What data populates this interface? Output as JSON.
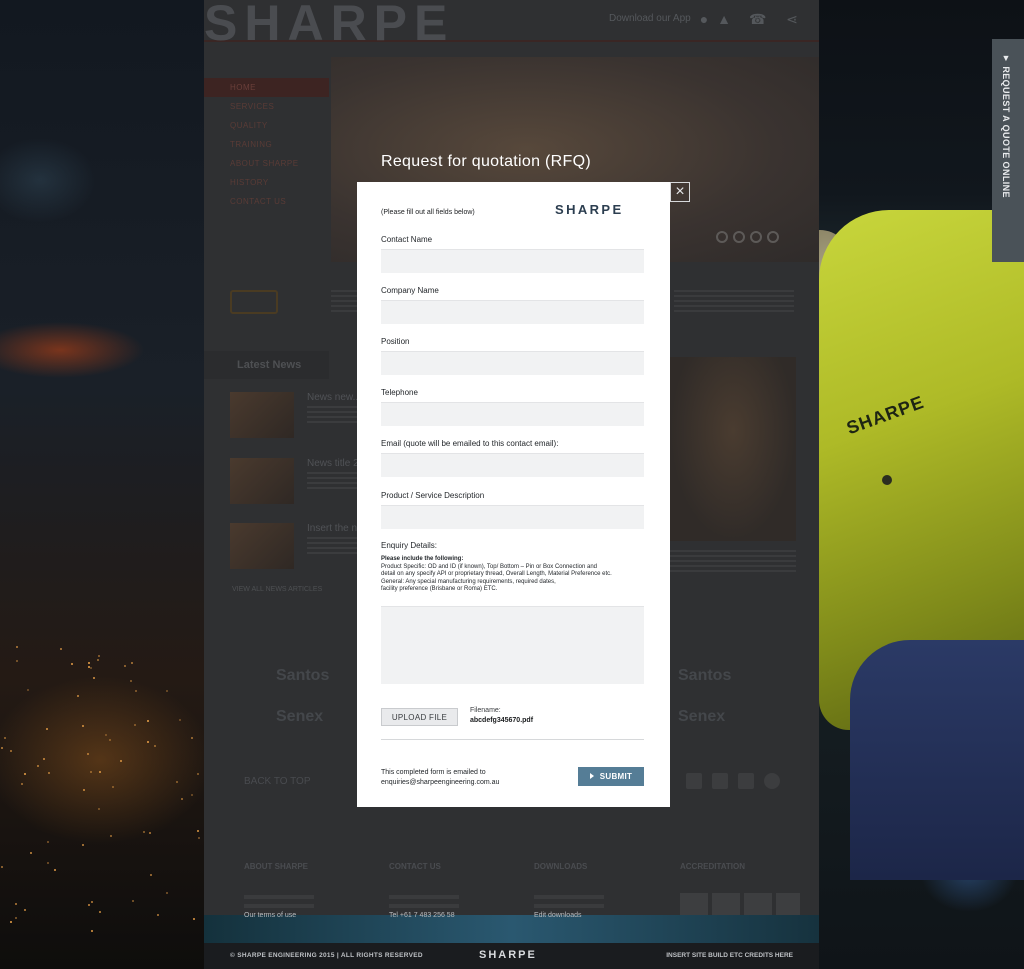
{
  "site": {
    "logo": "SHARPE",
    "download_app": "Download our App",
    "nav": [
      "HOME",
      "SERVICES",
      "QUALITY",
      "TRAINING",
      "ABOUT SHARPE",
      "HISTORY",
      "CONTACT US"
    ],
    "latest_news": "Latest News",
    "news_titles": [
      "News new...",
      "News title 2",
      "Insert the n..."
    ],
    "view_all": "VIEW ALL NEWS ARTICLES",
    "partners": [
      "Santos",
      "Senex",
      "Santos",
      "Senex"
    ],
    "back_to_top": "BACK TO TOP",
    "footer_cols": [
      "ABOUT SHARPE",
      "CONTACT US",
      "DOWNLOADS",
      "ACCREDITATION"
    ],
    "footer_bright": [
      "Our terms of use",
      "Tel +61 7 483 256 58",
      "Edit downloads"
    ],
    "copyright": "© SHARPE ENGINEERING 2015  |  ALL RIGHTS RESERVED",
    "bottom_brand": "SHARPE",
    "credits": "INSERT SITE BUILD ETC CREDITS HERE"
  },
  "quote_tab": {
    "label": "REQUEST A QUOTE ONLINE"
  },
  "modal": {
    "title": "Request for quotation (RFQ)",
    "close": "×",
    "note": "(Please fill out all fields below)",
    "logo": "SHARPE",
    "fields": {
      "contact_name": {
        "label": "Contact Name",
        "value": ""
      },
      "company_name": {
        "label": "Company Name",
        "value": ""
      },
      "position": {
        "label": "Position",
        "value": ""
      },
      "telephone": {
        "label": "Telephone",
        "value": ""
      },
      "email": {
        "label": "Email (quote will be emailed to this contact email):",
        "value": ""
      },
      "product": {
        "label": "Product / Service Description",
        "value": ""
      }
    },
    "enquiry": {
      "label": "Enquiry Details:",
      "include": "Please include the following:",
      "line1": "Product Specific: OD and ID (if known), Top/ Bottom – Pin or Box Connection and",
      "line2": "detail on any specify API or proprietary thread, Overall Length, Material Preference etc.",
      "line3": "General: Any special manufacturing requirements, required dates,",
      "line4": "facility preference (Brisbane or Roma) ETC."
    },
    "upload_label": "UPLOAD FILE",
    "filename_label": "Filename:",
    "filename": "abcdefg345670.pdf",
    "email_note_1": "This completed form is emailed to",
    "email_note_2": "enquiries@sharpeengineering.com.au",
    "submit": "SUBMIT"
  },
  "colors": {
    "accent": "#557d96",
    "modal_bg": "#ffffff",
    "field_bg": "#f1f2f3"
  }
}
